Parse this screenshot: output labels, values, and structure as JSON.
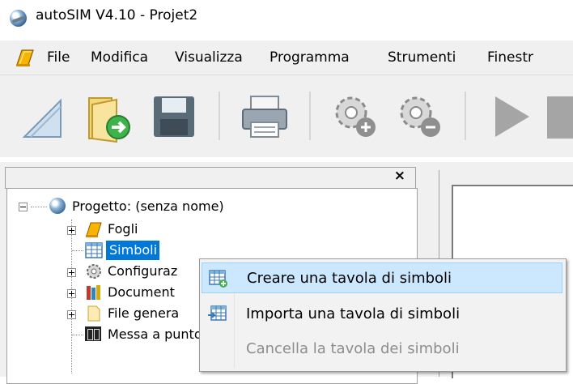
{
  "window": {
    "title": "autoSIM  V4.10 - Projet2"
  },
  "menubar": {
    "items": [
      {
        "label": "File"
      },
      {
        "label": "Modifica"
      },
      {
        "label": "Visualizza"
      },
      {
        "label": "Programma"
      },
      {
        "label": "Strumenti"
      },
      {
        "label": "Finestr"
      }
    ]
  },
  "toolbar": {
    "buttons": [
      {
        "icon": "new-sheet-icon"
      },
      {
        "icon": "open-folder-icon"
      },
      {
        "icon": "save-disk-icon"
      },
      {
        "icon": "print-icon"
      },
      {
        "icon": "gear-add-icon"
      },
      {
        "icon": "gear-remove-icon"
      },
      {
        "icon": "play-icon"
      }
    ]
  },
  "panel": {
    "close_label": "×"
  },
  "tree": {
    "root": {
      "label": "Progetto: (senza nome)"
    },
    "items": [
      {
        "label": "Fogli"
      },
      {
        "label": "Simboli",
        "selected": true
      },
      {
        "label": "Configuraz"
      },
      {
        "label": "Document"
      },
      {
        "label": "File genera"
      },
      {
        "label": "Messa a punto"
      }
    ]
  },
  "context_menu": {
    "items": [
      {
        "label": "Creare una tavola di simboli",
        "highlighted": true,
        "enabled": true
      },
      {
        "label": "Importa una tavola di simboli",
        "enabled": true
      },
      {
        "label": "Cancella la tavola dei simboli",
        "enabled": false
      }
    ]
  },
  "colors": {
    "selection": "#0078d7",
    "menu_highlight": "#cce8ff",
    "disabled_text": "#8d8d8d"
  }
}
